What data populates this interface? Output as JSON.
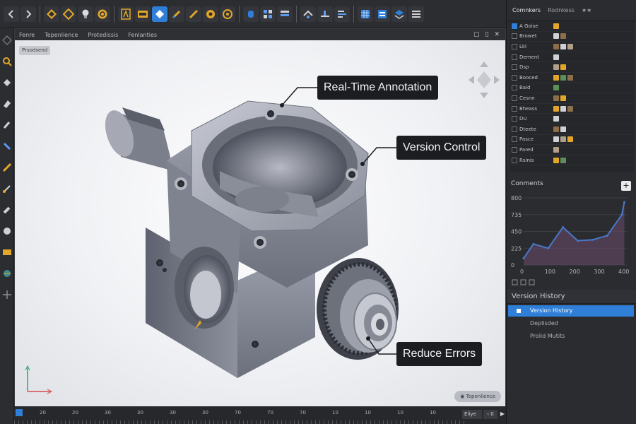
{
  "toolbar": {
    "icons": [
      "back-icon",
      "forward-icon",
      "diamond-icon",
      "diamond-outline-icon",
      "lightbulb-icon",
      "coin-icon",
      "text-frame-icon",
      "film-icon",
      "blue-diamond-icon",
      "pencil-icon",
      "ruler-icon",
      "gear-icon",
      "target-icon",
      "cylinder-icon",
      "grid-icon",
      "layers-icon",
      "measure-icon",
      "align-icon",
      "levels-icon",
      "grid-blue-icon",
      "table-icon",
      "stack-icon",
      "menu-icon"
    ]
  },
  "viewport": {
    "tabs": [
      "Fenre",
      "Tepenlience",
      "Protedissis",
      "Fenlanties"
    ],
    "doc_label": "Prsodsend",
    "bottom_chip": "Tepenlience",
    "callouts": {
      "real_time": "Real-Time Annotation",
      "version_control": "Version Control",
      "reduce_errors": "Reduce Errors"
    }
  },
  "timeline": {
    "ticks": [
      "20",
      "20",
      "30",
      "30",
      "30",
      "30",
      "70",
      "70",
      "70",
      "10",
      "10",
      "10",
      "10"
    ],
    "field": "Eliye",
    "ctrl": "‹ 0",
    "play": "▶"
  },
  "right_panel": {
    "tabs": [
      "Comnkers",
      "Rodnkess",
      "★★"
    ],
    "tree": [
      {
        "name": "A Goise",
        "checked": true
      },
      {
        "name": "Browet",
        "checked": false
      },
      {
        "name": "Lkl",
        "checked": false
      },
      {
        "name": "Dement",
        "checked": false
      },
      {
        "name": "Dsp",
        "checked": false
      },
      {
        "name": "Booced",
        "checked": false
      },
      {
        "name": "Baid",
        "checked": false
      },
      {
        "name": "Cesnn",
        "checked": false
      },
      {
        "name": "Bheass",
        "checked": false
      },
      {
        "name": "DU",
        "checked": false
      },
      {
        "name": "Dteete",
        "checked": false
      },
      {
        "name": "Pasce",
        "checked": false
      },
      {
        "name": "Pared",
        "checked": false
      },
      {
        "name": "Rsinis",
        "checked": false
      }
    ],
    "comments_title": "Conments",
    "add_label": "+",
    "version_history": {
      "title": "Version History",
      "items": [
        "Version History",
        "Deplisded",
        "Prolid Mutits"
      ],
      "selected_index": 0
    }
  },
  "chart_data": {
    "type": "area",
    "x": [
      0,
      40,
      100,
      160,
      220,
      280,
      340,
      400,
      410
    ],
    "values": [
      80,
      250,
      200,
      450,
      290,
      300,
      350,
      600,
      750
    ],
    "xticks": [
      "0",
      "100",
      "200",
      "300",
      "400"
    ],
    "yticks": [
      "800",
      "735",
      "450",
      "225",
      "0"
    ],
    "xlim": [
      0,
      420
    ],
    "ylim": [
      0,
      800
    ],
    "color": "#4a78c9"
  }
}
